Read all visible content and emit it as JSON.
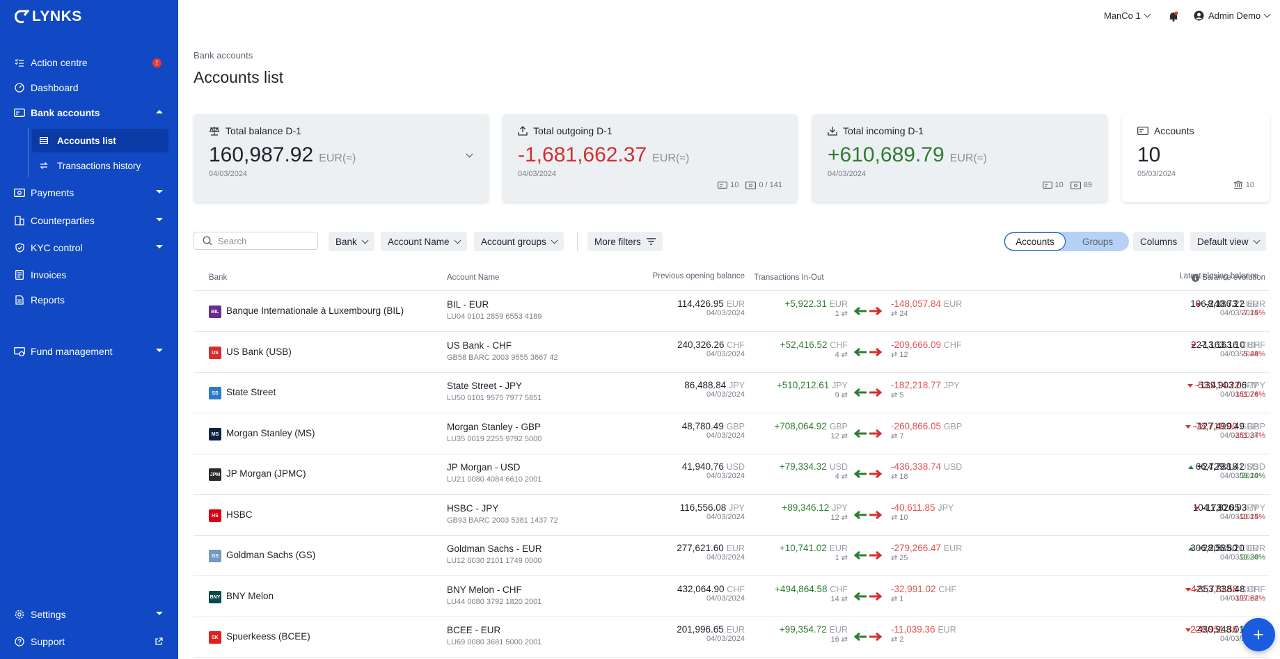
{
  "app": {
    "logo_text": "LYNKS"
  },
  "topbar": {
    "entity": "ManCo 1",
    "user": "Admin Demo"
  },
  "sidebar": {
    "action_centre": "Action centre",
    "action_badge": "!",
    "dashboard": "Dashboard",
    "bank_accounts": "Bank accounts",
    "accounts_list": "Accounts list",
    "transactions_history": "Transactions history",
    "payments": "Payments",
    "counterparties": "Counterparties",
    "kyc": "KYC control",
    "invoices": "Invoices",
    "reports": "Reports",
    "fund_management": "Fund management",
    "settings": "Settings",
    "support": "Support"
  },
  "page": {
    "breadcrumb": "Bank accounts",
    "title": "Accounts list"
  },
  "cards": {
    "balance": {
      "title": "Total balance D-1",
      "value": "160,987.92",
      "currency": "EUR(≈)",
      "date": "04/03/2024"
    },
    "outgoing": {
      "title": "Total outgoing D-1",
      "value": "-1,681,662.37",
      "currency": "EUR(≈)",
      "date": "04/03/2024",
      "accounts": "10",
      "transactions": "0 / 141"
    },
    "incoming": {
      "title": "Total incoming D-1",
      "value": "+610,689.79",
      "currency": "EUR(≈)",
      "date": "04/03/2024",
      "accounts": "10",
      "transactions": "89"
    },
    "accounts": {
      "title": "Accounts",
      "value": "10",
      "date": "05/03/2024",
      "banks": "10"
    }
  },
  "toolbar": {
    "search_placeholder": "Search",
    "bank": "Bank",
    "account_name": "Account Name",
    "account_groups": "Account groups",
    "more_filters": "More filters",
    "toggle_accounts": "Accounts",
    "toggle_groups": "Groups",
    "columns": "Columns",
    "default_view": "Default view"
  },
  "table": {
    "headers": {
      "bank": "Bank",
      "account_name": "Account Name",
      "prev_opening": "Previous opening balance",
      "transactions": "Transactions In-Out",
      "latest_closing": "Latest closing balance",
      "balance_evolution": "Balance evolution"
    },
    "rows": [
      {
        "bank": "Banque Internationale à Luxembourg (BIL)",
        "logo": "BIL",
        "logo_color": "#6b2c8f",
        "account": "BIL - EUR",
        "iban": "LU04 0101 2859 6553 4189",
        "cur": "EUR",
        "prev": "114,426.95",
        "prev_date": "04/03/2024",
        "in": "+5,922.31",
        "in_count": "1",
        "out": "-148,057.84",
        "out_count": "24",
        "close": "106,240.73",
        "close_neg": false,
        "close_date": "04/03/2024",
        "evo": "-8,186.22",
        "evo_dir": "down",
        "evo_pct": "-7.15%"
      },
      {
        "bank": "US Bank (USB)",
        "logo": "US",
        "logo_color": "#d32f2f",
        "account": "US Bank - CHF",
        "iban": "GB58 BARC 2003 9555 3667 42",
        "cur": "CHF",
        "prev": "240,326.26",
        "prev_date": "04/03/2024",
        "in": "+52,416.52",
        "in_count": "4",
        "out": "-209,666.09",
        "out_count": "12",
        "close": "227,163.16",
        "close_neg": false,
        "close_date": "04/03/2024",
        "evo": "-13,163.10",
        "evo_dir": "down",
        "evo_pct": "-5.48%"
      },
      {
        "bank": "State Street",
        "logo": "SS",
        "logo_color": "#2f79c9",
        "account": "State Street - JPY",
        "iban": "LU50 0101 9575 7977 5851",
        "cur": "JPY",
        "prev": "86,488.84",
        "prev_date": "04/03/2024",
        "in": "+510,212.61",
        "in_count": "9",
        "out": "-182,218.77",
        "out_count": "5",
        "close": "-53,414.22",
        "close_neg": true,
        "close_date": "04/03/2024",
        "evo": "-139,903.06",
        "evo_dir": "down",
        "evo_pct": "-161.76%"
      },
      {
        "bank": "Morgan Stanley (MS)",
        "logo": "MS",
        "logo_color": "#0d2340",
        "account": "Morgan Stanley - GBP",
        "iban": "LU35 0019 2255 9792 5000",
        "cur": "GBP",
        "prev": "48,780.49",
        "prev_date": "04/03/2024",
        "in": "+708,064.92",
        "in_count": "12",
        "out": "-260,866.05",
        "out_count": "7",
        "close": "-78,719.00",
        "close_neg": true,
        "close_date": "04/03/2024",
        "evo": "-127,499.49",
        "evo_dir": "down",
        "evo_pct": "-261.37%"
      },
      {
        "bank": "JP Morgan (JPMC)",
        "logo": "JPM",
        "logo_color": "#2b2b2b",
        "account": "JP Morgan - USD",
        "iban": "LU21 0080 4084 6610 2001",
        "cur": "USD",
        "prev": "41,940.76",
        "prev_date": "04/03/2024",
        "in": "+79,334.32",
        "in_count": "4",
        "out": "-436,338.74",
        "out_count": "18",
        "close": "66,729.18",
        "close_neg": false,
        "close_date": "04/03/2024",
        "evo": "+24,788.42",
        "evo_dir": "up",
        "evo_pct": "59.10%"
      },
      {
        "bank": "HSBC",
        "logo": "HS",
        "logo_color": "#db0011",
        "account": "HSBC - JPY",
        "iban": "GB93 BARC 2003 5381 1437 72",
        "cur": "JPY",
        "prev": "116,556.08",
        "prev_date": "04/03/2024",
        "in": "+89,346.12",
        "in_count": "12",
        "out": "-40,611.85",
        "out_count": "10",
        "close": "104,730.05",
        "close_neg": false,
        "close_date": "04/03/2024",
        "evo": "-11,826.03",
        "evo_dir": "down",
        "evo_pct": "-10.15%"
      },
      {
        "bank": "Goldman Sachs (GS)",
        "logo": "GS",
        "logo_color": "#7399c6",
        "account": "Goldman Sachs - EUR",
        "iban": "LU12 0030 2101 1749 0000",
        "cur": "EUR",
        "prev": "277,621.60",
        "prev_date": "04/03/2024",
        "in": "+10,741.02",
        "in_count": "1",
        "out": "-279,266.47",
        "out_count": "25",
        "close": "306,206.80",
        "close_neg": false,
        "close_date": "04/03/2024",
        "evo": "+28,585.20",
        "evo_dir": "up",
        "evo_pct": "10.30%"
      },
      {
        "bank": "BNY Melon",
        "logo": "BNY",
        "logo_color": "#0a4a4a",
        "account": "BNY Melon - CHF",
        "iban": "LU44 0080 3792 1820 2001",
        "cur": "CHF",
        "prev": "432,064.90",
        "prev_date": "04/03/2024",
        "in": "+494,864.58",
        "in_count": "14",
        "out": "-32,991.02",
        "out_count": "1",
        "close": "-421,773.58",
        "close_neg": true,
        "close_date": "04/03/2024",
        "evo": "-853,838.48",
        "evo_dir": "down",
        "evo_pct": "-197.62%"
      },
      {
        "bank": "Spuerkeess (BCEE)",
        "logo": "SK",
        "logo_color": "#e0201b",
        "account": "BCEE - EUR",
        "iban": "LU69 0080 3681 5000 2001",
        "cur": "EUR",
        "prev": "201,996.65",
        "prev_date": "04/03/2024",
        "in": "+99,354.72",
        "in_count": "16",
        "out": "-11,039.36",
        "out_count": "2",
        "close": "-228,951.36",
        "close_neg": true,
        "close_date": "04/03/2024",
        "evo": "-430,948.01",
        "evo_dir": "down",
        "evo_pct": "-213.3"
      }
    ]
  },
  "fab": {
    "label": "+"
  },
  "icons": {
    "sidebar_icons": [
      "list-check-icon",
      "gauge-icon",
      "bank-card-icon",
      "table-icon",
      "transfer-icon",
      "money-icon",
      "building-icon",
      "shield-icon",
      "document-icon",
      "report-icon",
      "fund-icon",
      "gear-icon",
      "help-icon"
    ]
  }
}
